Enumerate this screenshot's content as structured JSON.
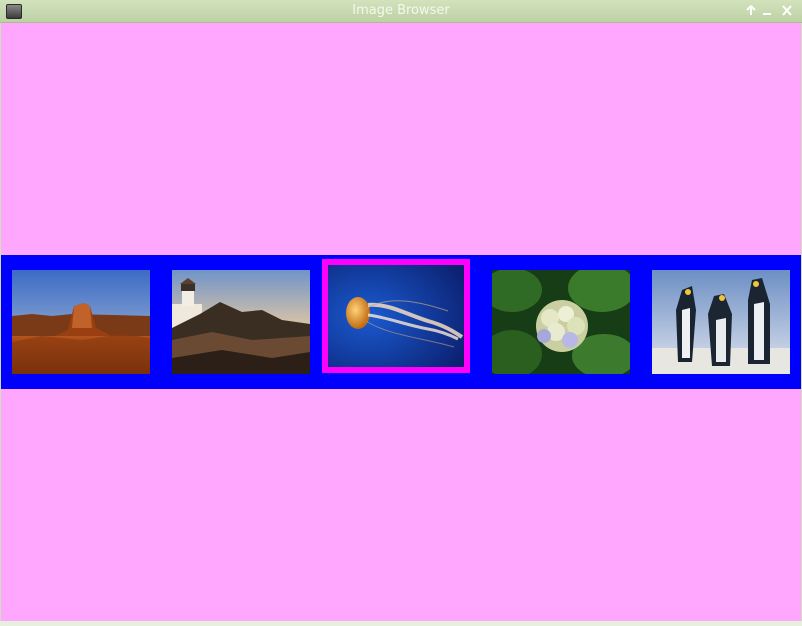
{
  "window": {
    "title": "Image Browser",
    "icons": {
      "app": "app-icon",
      "maximize": "arrow-up-icon",
      "minimize": "minimize-icon",
      "close": "close-icon"
    }
  },
  "colors": {
    "background": "#ffa7ff",
    "strip": "#0000ff",
    "selection": "#ff00ff",
    "titlebar": "#c8daaf"
  },
  "browser": {
    "selected_index": 2,
    "thumbnails": [
      {
        "subject": "desert-butte"
      },
      {
        "subject": "lighthouse"
      },
      {
        "subject": "jellyfish"
      },
      {
        "subject": "hydrangea-flower"
      },
      {
        "subject": "penguins"
      }
    ]
  }
}
